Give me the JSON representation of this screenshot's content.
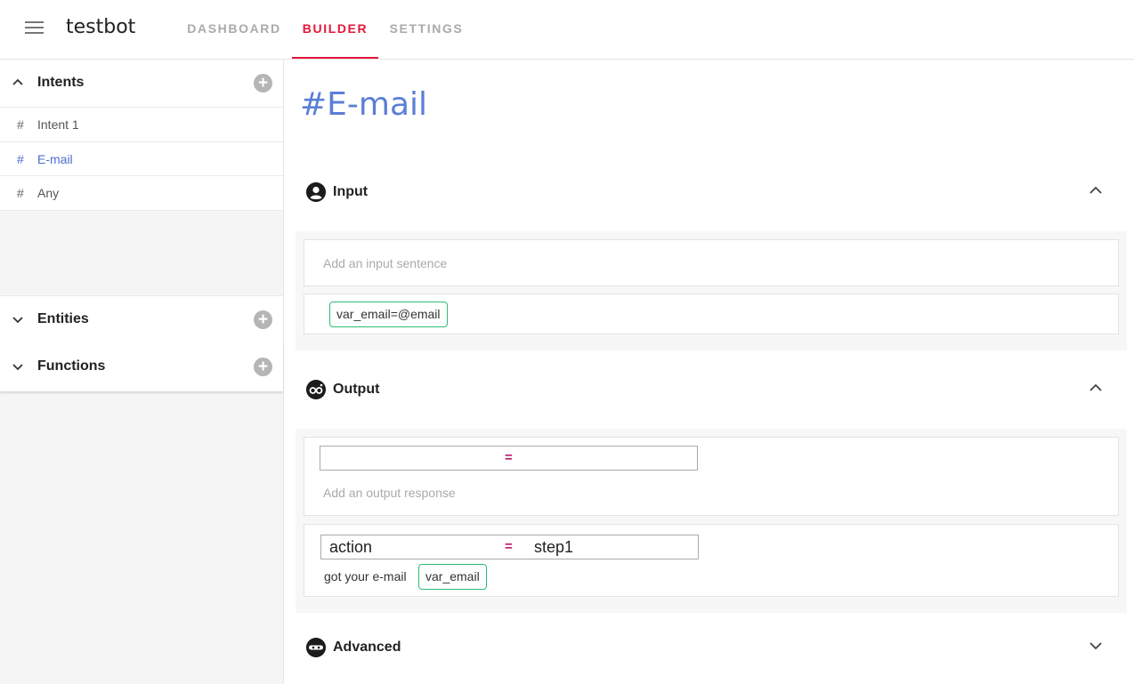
{
  "app": {
    "title": "testbot"
  },
  "tabs": [
    {
      "label": "DASHBOARD"
    },
    {
      "label": "BUILDER"
    },
    {
      "label": "SETTINGS"
    }
  ],
  "sidebar": {
    "intents": {
      "label": "Intents",
      "items": [
        {
          "hash": "#",
          "name": "Intent 1"
        },
        {
          "hash": "#",
          "name": "E-mail"
        },
        {
          "hash": "#",
          "name": "Any"
        }
      ]
    },
    "entities": {
      "label": "Entities"
    },
    "functions": {
      "label": "Functions"
    },
    "add_symbol": "+"
  },
  "main": {
    "title": "#E-mail",
    "input": {
      "label": "Input",
      "placeholder": "Add an input sentence",
      "chip": "var_email=@email"
    },
    "output": {
      "label": "Output",
      "empty_row": {
        "key": "",
        "eq": "=",
        "value": ""
      },
      "placeholder": "Add an output response",
      "row": {
        "key": "action",
        "eq": "=",
        "value": "step1"
      },
      "text": "got your e-mail",
      "chip": "var_email"
    },
    "advanced": {
      "label": "Advanced"
    }
  },
  "colors": {
    "accent": "#e4163a",
    "title_blue": "#5b7fd6",
    "chip_border": "#2bbd73",
    "equals": "#c01869"
  }
}
